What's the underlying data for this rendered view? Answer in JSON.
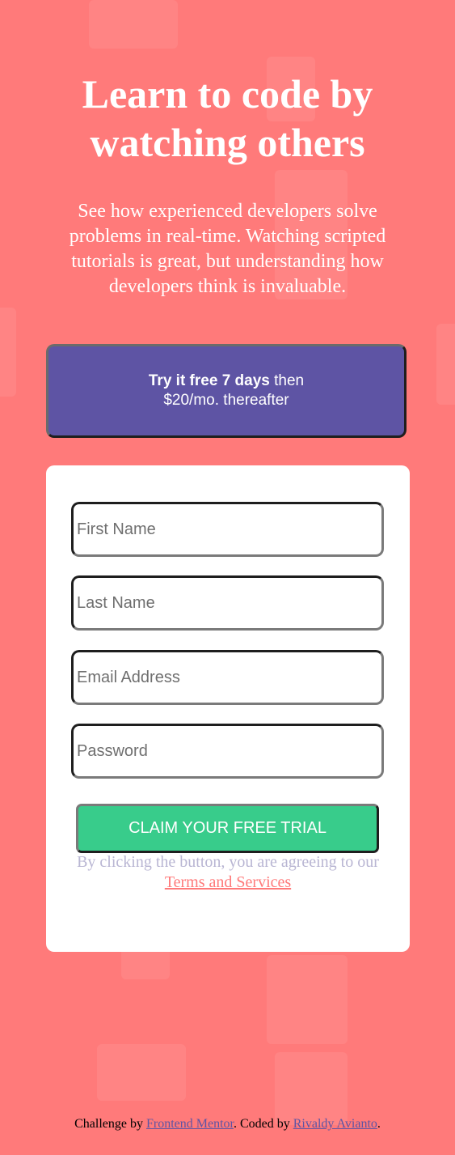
{
  "hero": {
    "title": "Learn to code by watching others",
    "description": "See how experienced developers solve problems in real-time. Watching scripted tutorials is great, but understanding how developers think is invaluable."
  },
  "promo": {
    "bold_text": "Try it free 7 days",
    "rest_text": " then $20/mo. thereafter"
  },
  "form": {
    "first_name_placeholder": "First Name",
    "last_name_placeholder": "Last Name",
    "email_placeholder": "Email Address",
    "password_placeholder": "Password",
    "submit_label": "CLAIM YOUR FREE TRIAL",
    "terms_text": "By clicking the button, you are agreeing to our ",
    "terms_link": "Terms and Services"
  },
  "footer": {
    "challenge_text": "Challenge by ",
    "frontend_mentor": "Frontend Mentor",
    "coded_by_text": ". Coded by ",
    "author": "Rivaldy Avianto",
    "end": "."
  },
  "colors": {
    "background": "#ff7a7a",
    "promo": "#5e54a4",
    "cta": "#38cc8b",
    "terms_grey": "#b9b6d3"
  }
}
